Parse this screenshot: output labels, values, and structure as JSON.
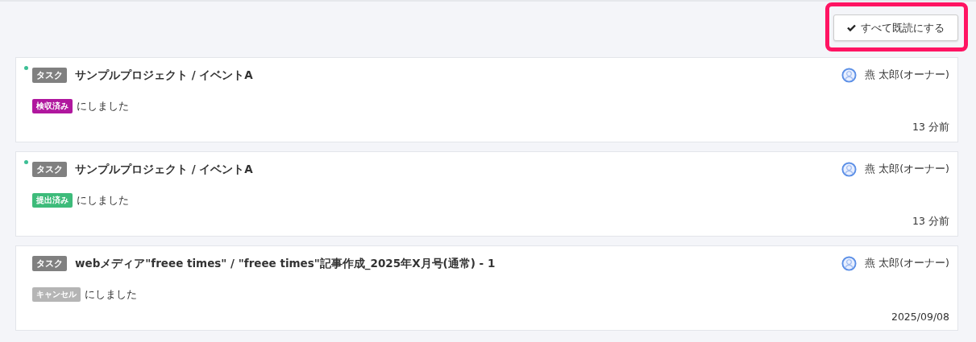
{
  "mark_all_read_button": {
    "label": "すべて既読にする",
    "highlighted": true
  },
  "notifications": [
    {
      "unread": true,
      "type_label": "タスク",
      "title": "サンプルプロジェクト / イベントA",
      "user": "燕 太郎(オーナー)",
      "status": {
        "label": "検収済み",
        "color": "#b0179e"
      },
      "message": "にしました",
      "time": "13 分前"
    },
    {
      "unread": true,
      "type_label": "タスク",
      "title": "サンプルプロジェクト / イベントA",
      "user": "燕 太郎(オーナー)",
      "status": {
        "label": "提出済み",
        "color": "#3dbb7a"
      },
      "message": "にしました",
      "time": "13 分前"
    },
    {
      "unread": false,
      "type_label": "タスク",
      "title": "webメディア\"freee times\" / \"freee times\"記事作成_2025年X月号(通常) - 1",
      "user": "燕 太郎(オーナー)",
      "status": {
        "label": "キャンセル",
        "color": "#b5b5b5"
      },
      "message": "にしました",
      "time": "2025/09/08"
    }
  ]
}
